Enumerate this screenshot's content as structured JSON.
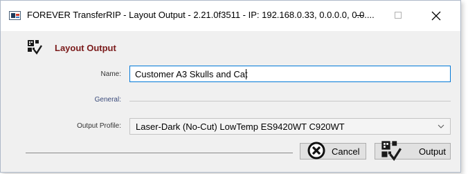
{
  "window": {
    "title": "FOREVER TransferRIP - Layout Output - 2.21.0f3511 - IP: 192.168.0.33, 0.0.0.0, 0.0....",
    "controls": [
      "minimize",
      "maximize",
      "close"
    ]
  },
  "section": {
    "heading": "Layout Output",
    "icon": "layout-output-icon"
  },
  "form": {
    "name_label": "Name:",
    "name_value": "Customer A3 Skulls and Cat",
    "general_label": "General:",
    "output_profile_label": "Output Profile:",
    "output_profile_value": "Laser-Dark (No-Cut) LowTemp ES9420WT  C920WT"
  },
  "buttons": {
    "cancel_label": "Cancel",
    "output_label": "Output"
  },
  "colors": {
    "heading": "#7a1a1a",
    "input_focus_border": "#0078d7"
  }
}
